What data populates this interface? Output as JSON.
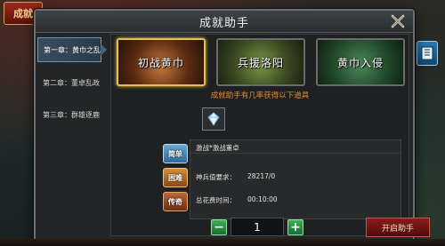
{
  "background": {
    "banner_text": "成就"
  },
  "dialog": {
    "title": "成就助手"
  },
  "sidebar": {
    "items": [
      {
        "label": "第一章：黄巾之乱"
      },
      {
        "label": "第二章：董卓乱政"
      },
      {
        "label": "第三章：群雄逐鹿"
      }
    ]
  },
  "battles": [
    {
      "label": "初战黄巾"
    },
    {
      "label": "兵援洛阳"
    },
    {
      "label": "黄巾入侵"
    }
  ],
  "notice": "成就助手有几率获得以下道具",
  "badges": [
    {
      "label": "简单"
    },
    {
      "label": "困难"
    },
    {
      "label": "传奇"
    }
  ],
  "info": {
    "name": "激战*激战董卓",
    "power_label": "神兵值要求：",
    "power_value": "28217/0",
    "time_label": "总花费时间：",
    "time_value": "00:10:00"
  },
  "stepper": {
    "minus": "−",
    "plus": "+",
    "value": "1"
  },
  "start_button": "开启助手",
  "colors": {
    "accent_gold": "#e7c24a",
    "notice_orange": "#e78a2a",
    "start_red": "#8a1c1c",
    "stepper_green": "#3fae5a"
  }
}
